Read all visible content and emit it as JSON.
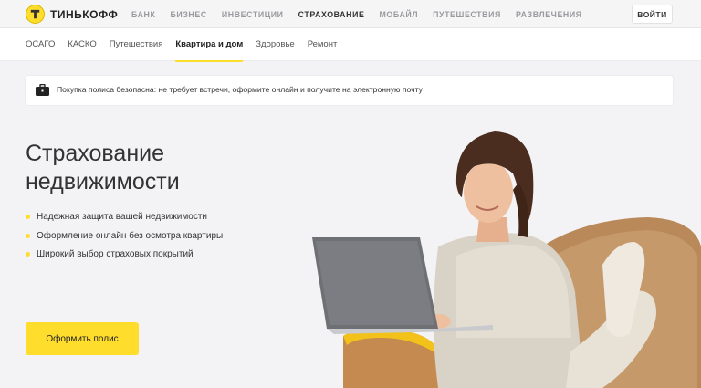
{
  "brand": {
    "name": "ТИНЬКОФФ"
  },
  "topnav": {
    "items": [
      {
        "label": "БАНК",
        "active": false
      },
      {
        "label": "БИЗНЕС",
        "active": false
      },
      {
        "label": "ИНВЕСТИЦИИ",
        "active": false
      },
      {
        "label": "СТРАХОВАНИЕ",
        "active": true
      },
      {
        "label": "МОБАЙЛ",
        "active": false
      },
      {
        "label": "ПУТЕШЕСТВИЯ",
        "active": false
      },
      {
        "label": "РАЗВЛЕЧЕНИЯ",
        "active": false
      }
    ],
    "login_label": "ВОЙТИ"
  },
  "subnav": {
    "items": [
      {
        "label": "ОСАГО",
        "active": false
      },
      {
        "label": "КАСКО",
        "active": false
      },
      {
        "label": "Путешествия",
        "active": false
      },
      {
        "label": "Квартира и дом",
        "active": true
      },
      {
        "label": "Здоровье",
        "active": false
      },
      {
        "label": "Ремонт",
        "active": false
      }
    ]
  },
  "notice": {
    "icon": "briefcase-icon",
    "text": "Покупка полиса безопасна: не требует встречи, оформите онлайн и получите на электронную почту"
  },
  "hero": {
    "title_line1": "Страхование",
    "title_line2": "недвижимости",
    "bullets": [
      "Надежная защита вашей недвижимости",
      "Оформление онлайн без осмотра квартиры",
      "Широкий выбор страховых покрытий"
    ],
    "cta_label": "Оформить полис"
  },
  "colors": {
    "accent": "#ffdd2d",
    "background": "#f3f3f5",
    "text": "#333333"
  }
}
